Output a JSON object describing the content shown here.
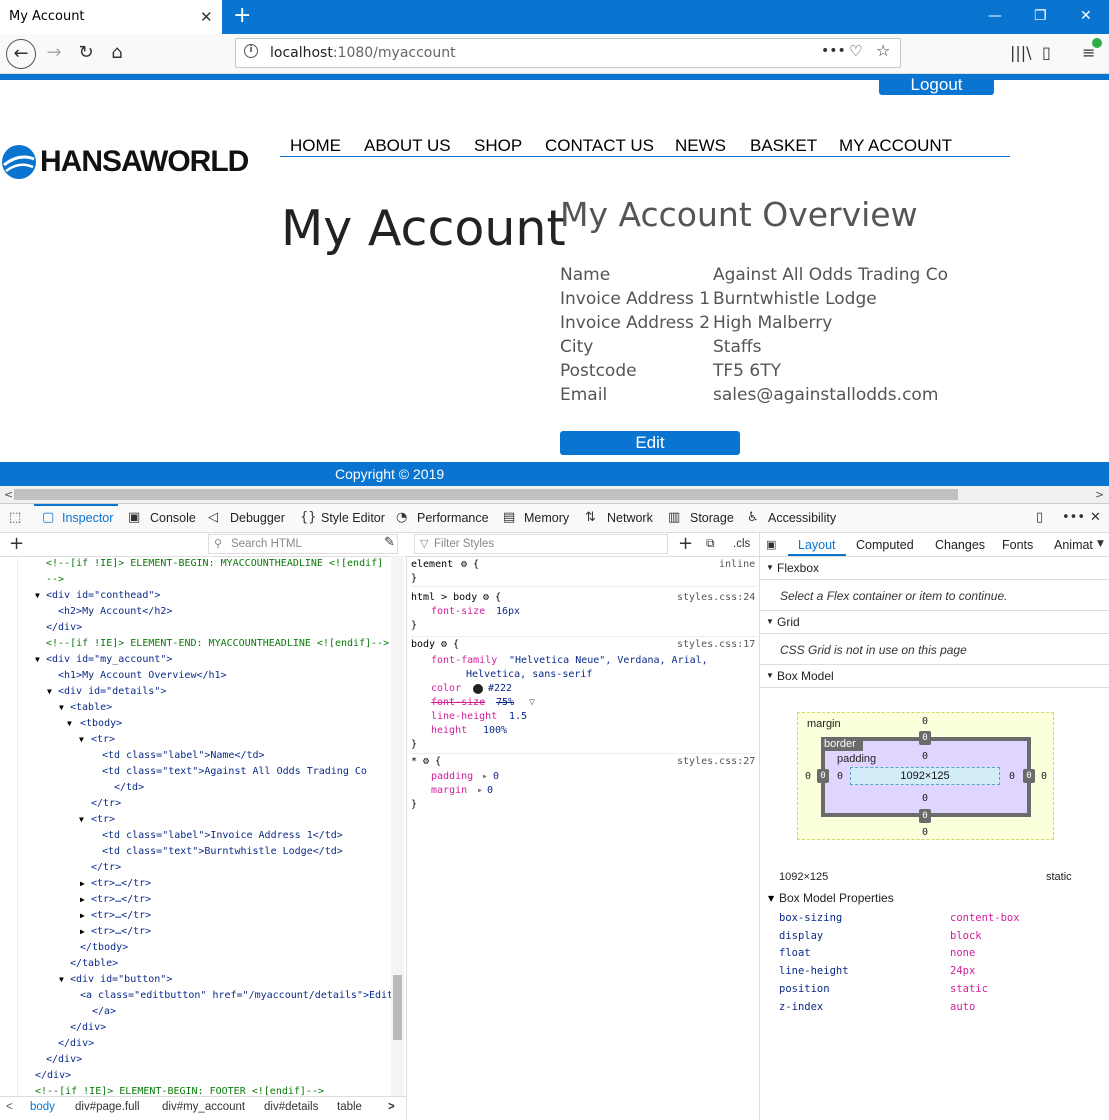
{
  "browser": {
    "tab_title": "My Account",
    "url_host": "localhost",
    "url_path": ":1080/myaccount"
  },
  "page": {
    "logout": "Logout",
    "logo_text": "HANSAWORLD",
    "menu": [
      "HOME",
      "ABOUT US",
      "SHOP",
      "CONTACT US",
      "NEWS",
      "BASKET",
      "MY ACCOUNT"
    ],
    "heading": "My Account",
    "overview_title": "My Account Overview",
    "details": [
      {
        "label": "Name",
        "value": "Against All Odds Trading Co"
      },
      {
        "label": "Invoice Address 1",
        "value": "Burntwhistle Lodge"
      },
      {
        "label": "Invoice Address 2",
        "value": "High Malberry"
      },
      {
        "label": "City",
        "value": "Staffs"
      },
      {
        "label": "Postcode",
        "value": "TF5 6TY"
      },
      {
        "label": "Email",
        "value": "sales@againstallodds.com"
      }
    ],
    "edit": "Edit",
    "copyright": "Copyright © 2019"
  },
  "devtools": {
    "tabs": [
      "Inspector",
      "Console",
      "Debugger",
      "Style Editor",
      "Performance",
      "Memory",
      "Network",
      "Storage",
      "Accessibility"
    ],
    "search_html_placeholder": "Search HTML",
    "filter_styles_placeholder": "Filter Styles",
    "cls": ".cls",
    "html_lines": [
      "<!--[if !IE]> ELEMENT-BEGIN: MYACCOUNTHEADLINE <![endif]",
      "-->",
      "<div id=\"conthead\">",
      "<h2>My Account</h2>",
      "</div>",
      "<!--[if !IE]> ELEMENT-END: MYACCOUNTHEADLINE <![endif]-->",
      "<div id=\"my_account\">",
      "<h1>My Account Overview</h1>",
      "<div id=\"details\">",
      "<table>",
      "<tbody>",
      "<tr>",
      "<td class=\"label\">Name</td>",
      "<td class=\"text\">Against All Odds Trading Co",
      "</td>",
      "</tr>",
      "<tr>",
      "<td class=\"label\">Invoice Address 1</td>",
      "<td class=\"text\">Burntwhistle Lodge</td>",
      "</tr>",
      "<tr>…</tr>",
      "<tr>…</tr>",
      "<tr>…</tr>",
      "<tr>…</tr>",
      "</tbody>",
      "</table>",
      "<div id=\"button\">",
      "<a class=\"editbutton\" href=\"/myaccount/details\">Edit",
      "</a>",
      "</div>",
      "</div>",
      "</div>",
      "</div>",
      "<!--[if !IE]> ELEMENT-BEGIN: FOOTER <![endif]-->"
    ],
    "rules": [
      {
        "selector": "element",
        "source": "inline",
        "decls": []
      },
      {
        "selector": "html > body",
        "source": "styles.css:24",
        "decls": [
          [
            "font-size",
            "16px"
          ]
        ]
      },
      {
        "selector": "body",
        "source": "styles.css:17",
        "decls": [
          [
            "font-family",
            "\"Helvetica Neue\", Verdana, Arial,"
          ],
          [
            "",
            "Helvetica, sans-serif"
          ],
          [
            "color",
            "#222"
          ],
          [
            "font-size",
            "75%"
          ],
          [
            "line-height",
            "1.5"
          ],
          [
            "height",
            "100%"
          ]
        ]
      },
      {
        "selector": "*",
        "source": "styles.css:27",
        "decls": [
          [
            "padding",
            "0"
          ],
          [
            "margin",
            "0"
          ]
        ]
      }
    ],
    "right_tabs": [
      "Layout",
      "Computed",
      "Changes",
      "Fonts",
      "Animat"
    ],
    "flexbox": "Flexbox",
    "flexbox_msg": "Select a Flex container or item to continue.",
    "grid": "Grid",
    "grid_msg": "CSS Grid is not in use on this page",
    "box_model": "Box Model",
    "bm_margin": "margin",
    "bm_border": "border",
    "bm_padding": "padding",
    "bm_size": "1092×125",
    "bm_zero": "0",
    "bm_dims": "1092×125",
    "bm_position": "static",
    "bm_props_title": "Box Model Properties",
    "bm_props": [
      {
        "name": "box-sizing",
        "value": "content-box"
      },
      {
        "name": "display",
        "value": "block"
      },
      {
        "name": "float",
        "value": "none"
      },
      {
        "name": "line-height",
        "value": "24px"
      },
      {
        "name": "position",
        "value": "static"
      },
      {
        "name": "z-index",
        "value": "auto"
      }
    ],
    "breadcrumbs": [
      "body",
      "div#page.full",
      "div#my_account",
      "div#details",
      "table"
    ]
  },
  "colors": {
    "brand_blue": "#0a74d1"
  }
}
